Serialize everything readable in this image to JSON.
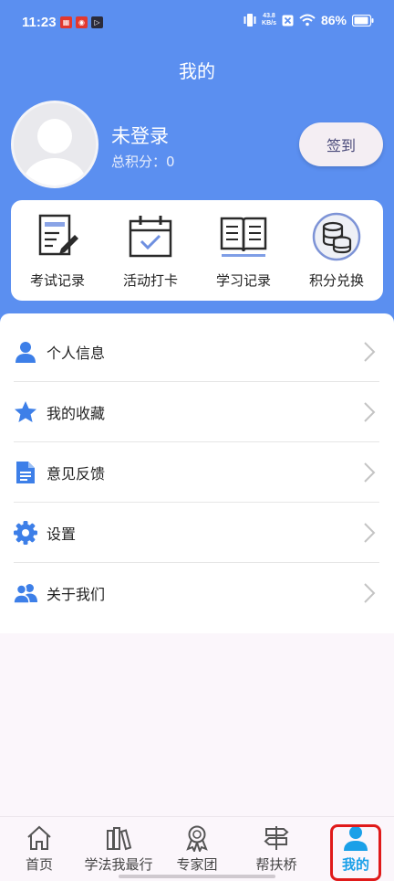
{
  "status_bar": {
    "time": "11:23",
    "net_speed_value": "43.8",
    "net_speed_unit": "KB/s",
    "battery": "86%"
  },
  "header": {
    "title": "我的"
  },
  "profile": {
    "username": "未登录",
    "points": "总积分：0",
    "checkin_label": "签到"
  },
  "shortcuts": [
    {
      "label": "考试记录",
      "icon": "exam-record-icon"
    },
    {
      "label": "活动打卡",
      "icon": "calendar-check-icon"
    },
    {
      "label": "学习记录",
      "icon": "open-book-icon"
    },
    {
      "label": "积分兑换",
      "icon": "coins-stack-icon"
    }
  ],
  "menu": [
    {
      "label": "个人信息",
      "icon": "person-icon"
    },
    {
      "label": "我的收藏",
      "icon": "star-icon"
    },
    {
      "label": "意见反馈",
      "icon": "document-icon"
    },
    {
      "label": "设置",
      "icon": "gear-icon"
    },
    {
      "label": "关于我们",
      "icon": "group-icon"
    }
  ],
  "tabbar": [
    {
      "label": "首页",
      "icon": "home-icon"
    },
    {
      "label": "学法我最行",
      "icon": "books-icon"
    },
    {
      "label": "专家团",
      "icon": "award-icon"
    },
    {
      "label": "帮扶桥",
      "icon": "signpost-icon"
    },
    {
      "label": "我的",
      "icon": "user-icon",
      "active": true
    }
  ],
  "colors": {
    "header": "#5b8ff0",
    "accent_blue": "#3d7fe8",
    "active_tab": "#1aa0e8",
    "highlight": "#e01a1a"
  }
}
